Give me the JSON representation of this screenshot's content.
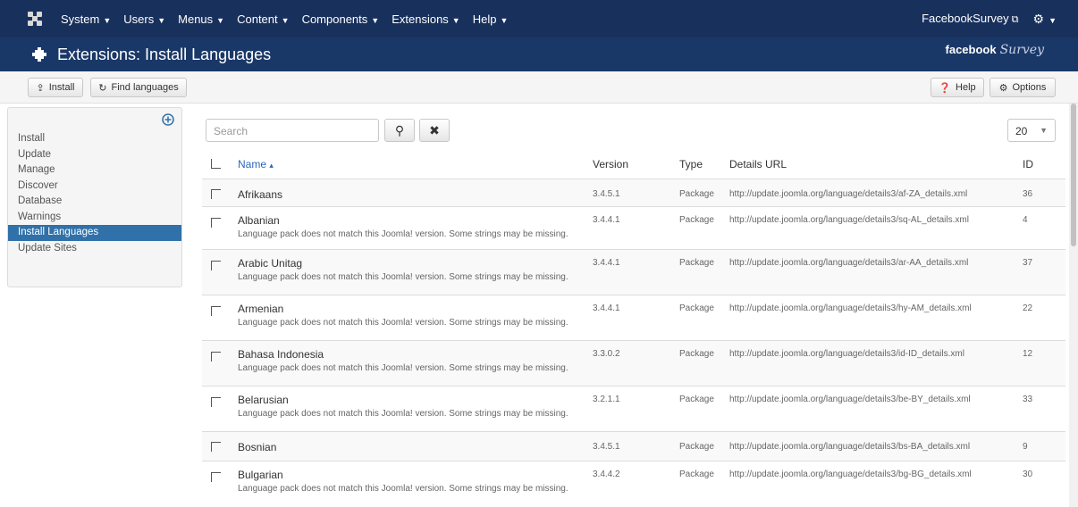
{
  "topbar": {
    "menus": [
      {
        "label": "System"
      },
      {
        "label": "Users"
      },
      {
        "label": "Menus"
      },
      {
        "label": "Content"
      },
      {
        "label": "Components"
      },
      {
        "label": "Extensions"
      },
      {
        "label": "Help"
      }
    ],
    "site_label": "FacebookSurvey",
    "icons": {
      "logo": "joomla-logo-icon",
      "external": "external-link-icon",
      "settings": "gear-icon"
    }
  },
  "titlebar": {
    "title": "Extensions: Install Languages",
    "brand_facebook": "facebook",
    "brand_survey": "Survey"
  },
  "toolbar": {
    "install_label": "Install",
    "find_label": "Find languages",
    "help_label": "Help",
    "options_label": "Options"
  },
  "sidebar": {
    "items": [
      {
        "label": "Install",
        "active": false
      },
      {
        "label": "Update",
        "active": false
      },
      {
        "label": "Manage",
        "active": false
      },
      {
        "label": "Discover",
        "active": false
      },
      {
        "label": "Database",
        "active": false
      },
      {
        "label": "Warnings",
        "active": false
      },
      {
        "label": "Install Languages",
        "active": true
      },
      {
        "label": "Update Sites",
        "active": false
      }
    ]
  },
  "filter": {
    "search_placeholder": "Search",
    "limit": "20"
  },
  "table": {
    "headers": {
      "name": "Name",
      "version": "Version",
      "type": "Type",
      "details": "Details URL",
      "id": "ID"
    },
    "warning_text": "Language pack does not match this Joomla! version. Some strings may be missing.",
    "rows": [
      {
        "name": "Afrikaans",
        "version": "3.4.5.1",
        "type": "Package",
        "url": "http://update.joomla.org/language/details3/af-ZA_details.xml",
        "id": "36",
        "warn": false
      },
      {
        "name": "Albanian",
        "version": "3.4.4.1",
        "type": "Package",
        "url": "http://update.joomla.org/language/details3/sq-AL_details.xml",
        "id": "4",
        "warn": true
      },
      {
        "name": "Arabic Unitag",
        "version": "3.4.4.1",
        "type": "Package",
        "url": "http://update.joomla.org/language/details3/ar-AA_details.xml",
        "id": "37",
        "warn": true
      },
      {
        "name": "Armenian",
        "version": "3.4.4.1",
        "type": "Package",
        "url": "http://update.joomla.org/language/details3/hy-AM_details.xml",
        "id": "22",
        "warn": true
      },
      {
        "name": "Bahasa Indonesia",
        "version": "3.3.0.2",
        "type": "Package",
        "url": "http://update.joomla.org/language/details3/id-ID_details.xml",
        "id": "12",
        "warn": true
      },
      {
        "name": "Belarusian",
        "version": "3.2.1.1",
        "type": "Package",
        "url": "http://update.joomla.org/language/details3/be-BY_details.xml",
        "id": "33",
        "warn": true
      },
      {
        "name": "Bosnian",
        "version": "3.4.5.1",
        "type": "Package",
        "url": "http://update.joomla.org/language/details3/bs-BA_details.xml",
        "id": "9",
        "warn": false
      },
      {
        "name": "Bulgarian",
        "version": "3.4.4.2",
        "type": "Package",
        "url": "http://update.joomla.org/language/details3/bg-BG_details.xml",
        "id": "30",
        "warn": true
      }
    ]
  },
  "colors": {
    "topbar": "#18305c",
    "titlebar": "#1a3867",
    "active": "#3071a9",
    "link": "#2a69b8"
  }
}
